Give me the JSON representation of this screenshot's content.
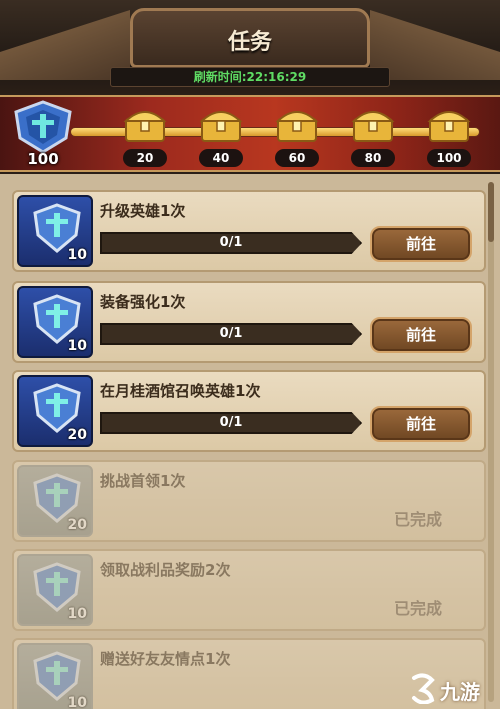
{
  "header": {
    "title": "任务",
    "refresh_label": "刷新时间:22:16:29"
  },
  "rewards": {
    "current_points": "100",
    "progress_fraction": 1.0,
    "milestones": [
      "20",
      "40",
      "60",
      "80",
      "100"
    ]
  },
  "tasks": [
    {
      "title": "升级英雄1次",
      "icon_value": "10",
      "progress": "0/1",
      "button": "前往",
      "status": "pending"
    },
    {
      "title": "装备强化1次",
      "icon_value": "10",
      "progress": "0/1",
      "button": "前往",
      "status": "pending"
    },
    {
      "title": "在月桂酒馆召唤英雄1次",
      "icon_value": "20",
      "progress": "0/1",
      "button": "前往",
      "status": "pending"
    },
    {
      "title": "挑战首领1次",
      "icon_value": "20",
      "done_label": "已完成",
      "status": "done"
    },
    {
      "title": "领取战利品奖励2次",
      "icon_value": "10",
      "done_label": "已完成",
      "status": "done"
    },
    {
      "title": "赠送好友友情点1次",
      "icon_value": "10",
      "status": "done"
    }
  ],
  "watermark": {
    "text": "九游",
    "icon": "nine-game-logo-icon"
  },
  "colors": {
    "refresh_green": "#5fdc64",
    "reward_red": "#b8371f",
    "icon_blue": "#2e4fa8",
    "button_brown": "#9c6a3c"
  }
}
